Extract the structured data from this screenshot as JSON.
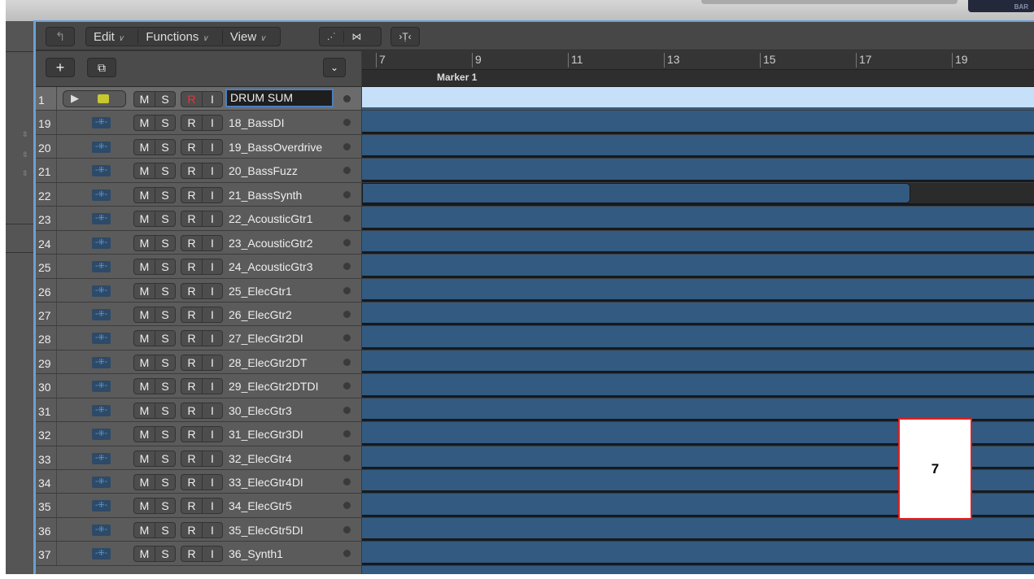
{
  "top": {
    "bar_label": "BAR"
  },
  "toolbar": {
    "edit": "Edit",
    "functions": "Functions",
    "view": "View"
  },
  "ruler": {
    "bars": [
      "7",
      "9",
      "11",
      "13",
      "15",
      "17",
      "19"
    ],
    "marker": "Marker 1"
  },
  "tracks": [
    {
      "idx": "1",
      "name": "DRUM SUM",
      "selected": true
    },
    {
      "idx": "19",
      "name": "18_BassDI"
    },
    {
      "idx": "20",
      "name": "19_BassOverdrive"
    },
    {
      "idx": "21",
      "name": "20_BassFuzz"
    },
    {
      "idx": "22",
      "name": "21_BassSynth",
      "short": true
    },
    {
      "idx": "23",
      "name": "22_AcousticGtr1"
    },
    {
      "idx": "24",
      "name": "23_AcousticGtr2"
    },
    {
      "idx": "25",
      "name": "24_AcousticGtr3"
    },
    {
      "idx": "26",
      "name": "25_ElecGtr1"
    },
    {
      "idx": "27",
      "name": "26_ElecGtr2"
    },
    {
      "idx": "28",
      "name": "27_ElecGtr2DI"
    },
    {
      "idx": "29",
      "name": "28_ElecGtr2DT"
    },
    {
      "idx": "30",
      "name": "29_ElecGtr2DTDI"
    },
    {
      "idx": "31",
      "name": "30_ElecGtr3"
    },
    {
      "idx": "32",
      "name": "31_ElecGtr3DI"
    },
    {
      "idx": "33",
      "name": "32_ElecGtr4"
    },
    {
      "idx": "34",
      "name": "33_ElecGtr4DI"
    },
    {
      "idx": "35",
      "name": "34_ElecGtr5"
    },
    {
      "idx": "36",
      "name": "35_ElecGtr5DI"
    },
    {
      "idx": "37",
      "name": "36_Synth1"
    }
  ],
  "buttons": {
    "m": "M",
    "s": "S",
    "r": "R",
    "i": "I"
  },
  "overlay": {
    "label": "7"
  }
}
